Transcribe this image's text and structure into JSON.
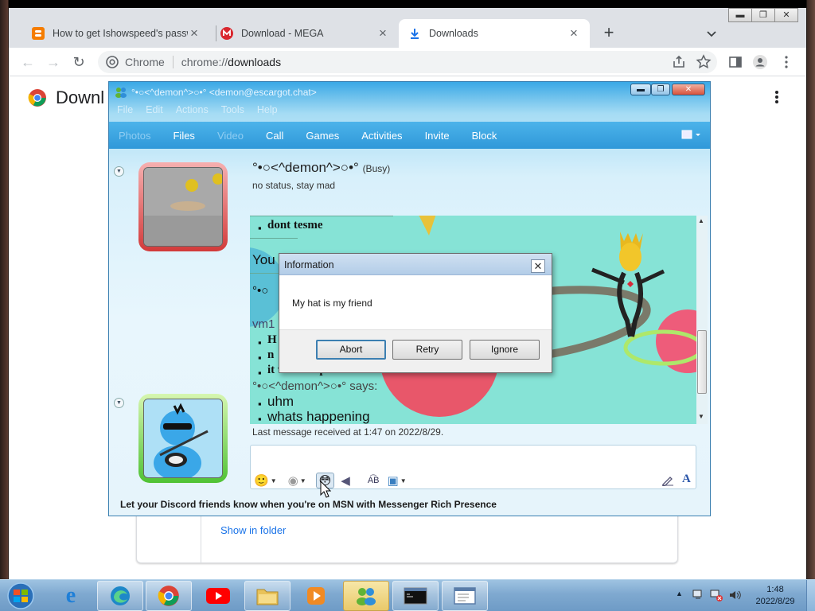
{
  "browser": {
    "tabs": [
      {
        "title": "How to get Ishowspeed's passwo",
        "icon": "blogger-icon",
        "active": false
      },
      {
        "title": "Download - MEGA",
        "icon": "mega-icon",
        "active": false
      },
      {
        "title": "Downloads",
        "icon": "download-icon",
        "active": true
      }
    ],
    "site_chip": "Chrome",
    "url_prefix": "chrome://",
    "url_host": "downloads",
    "page_heading": "Downl",
    "show_in_folder": "Show in folder"
  },
  "messenger": {
    "title": "°•○<^demon^>○•° <demon@escargot.chat>",
    "menu": [
      "File",
      "Edit",
      "Actions",
      "Tools",
      "Help"
    ],
    "toolbar": [
      {
        "label": "Photos",
        "enabled": false
      },
      {
        "label": "Files",
        "enabled": true
      },
      {
        "label": "Video",
        "enabled": false
      },
      {
        "label": "Call",
        "enabled": true
      },
      {
        "label": "Games",
        "enabled": true
      },
      {
        "label": "Activities",
        "enabled": true
      },
      {
        "label": "Invite",
        "enabled": true
      },
      {
        "label": "Block",
        "enabled": true
      }
    ],
    "contact_name": "°•○<^demon^>○•°",
    "contact_state": "(Busy)",
    "contact_status": "no status, stay mad",
    "conversation": {
      "line1": "dont tesme",
      "line2": "You",
      "line3": "°•○",
      "line4": "vm1",
      "line5": "H",
      "line6": "n",
      "line7": "it was not passwrrrrr",
      "says": "°•○<^demon^>○•° says:",
      "msg1": "uhm",
      "msg2": "whats happening"
    },
    "last_message": "Last message received at 1:47 on 2022/8/29.",
    "banner": "Let your Discord friends know when you're on MSN with Messenger Rich Presence"
  },
  "dialog": {
    "title": "Information",
    "message": "My hat is my friend",
    "buttons": [
      "Abort",
      "Retry",
      "Ignore"
    ]
  },
  "taskbar": {
    "time": "1:48",
    "date": "2022/8/29"
  },
  "colors": {
    "chrome_tabstrip": "#dee1e6",
    "msn_toolbar": "#2f98d9",
    "dialog_titlebar": "#b3cde8",
    "taskbar": "#7fa9d0"
  }
}
